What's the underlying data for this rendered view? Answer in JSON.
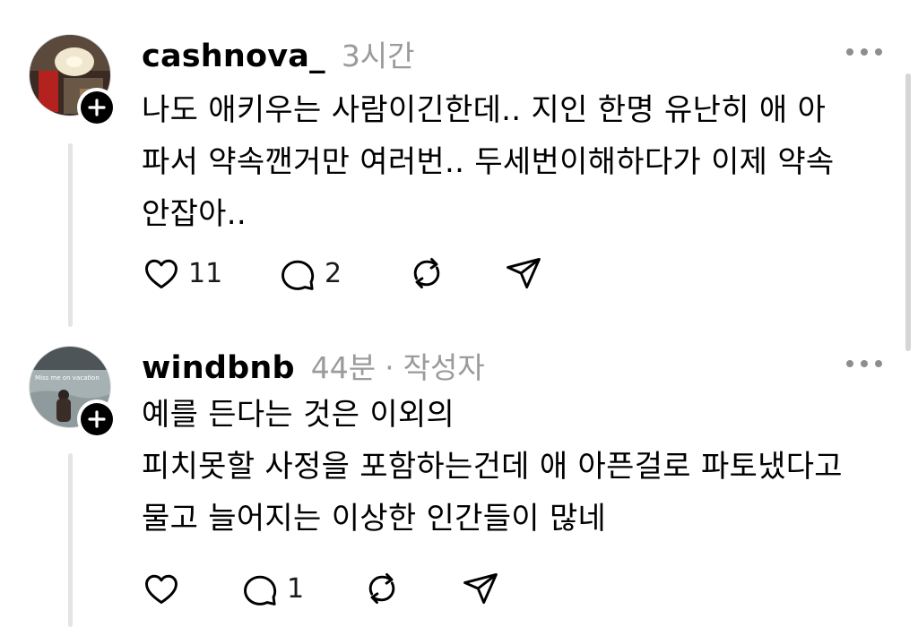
{
  "colors": {
    "text": "#000000",
    "meta": "#9b9b9b",
    "thread_line": "#e4e4e4",
    "badge": "#000000"
  },
  "posts": [
    {
      "username": "cashnova_",
      "time": "3시간",
      "lines": [
        "나도 애키우는 사람이긴한데.. 지인 한명 유난히 애 아",
        "파서 약속깬거만 여러번.. 두세번이해하다가 이제 약속",
        "안잡아.."
      ],
      "likes": "11",
      "replies": "2",
      "icons": [
        "heart-icon",
        "comment-icon",
        "repost-icon",
        "share-icon"
      ]
    },
    {
      "username": "windbnb",
      "time": "44분",
      "separator": "·",
      "author_tag": "작성자",
      "avatar_caption": "Miss me on vacation",
      "lines": [
        "예를 든다는 것은 이외의",
        "피치못할 사정을 포함하는건데 애 아픈걸로 파토냈다고",
        "물고 늘어지는 이상한 인간들이 많네"
      ],
      "likes": "",
      "replies": "1",
      "icons": [
        "heart-icon",
        "comment-icon",
        "repost-icon",
        "share-icon"
      ]
    }
  ]
}
